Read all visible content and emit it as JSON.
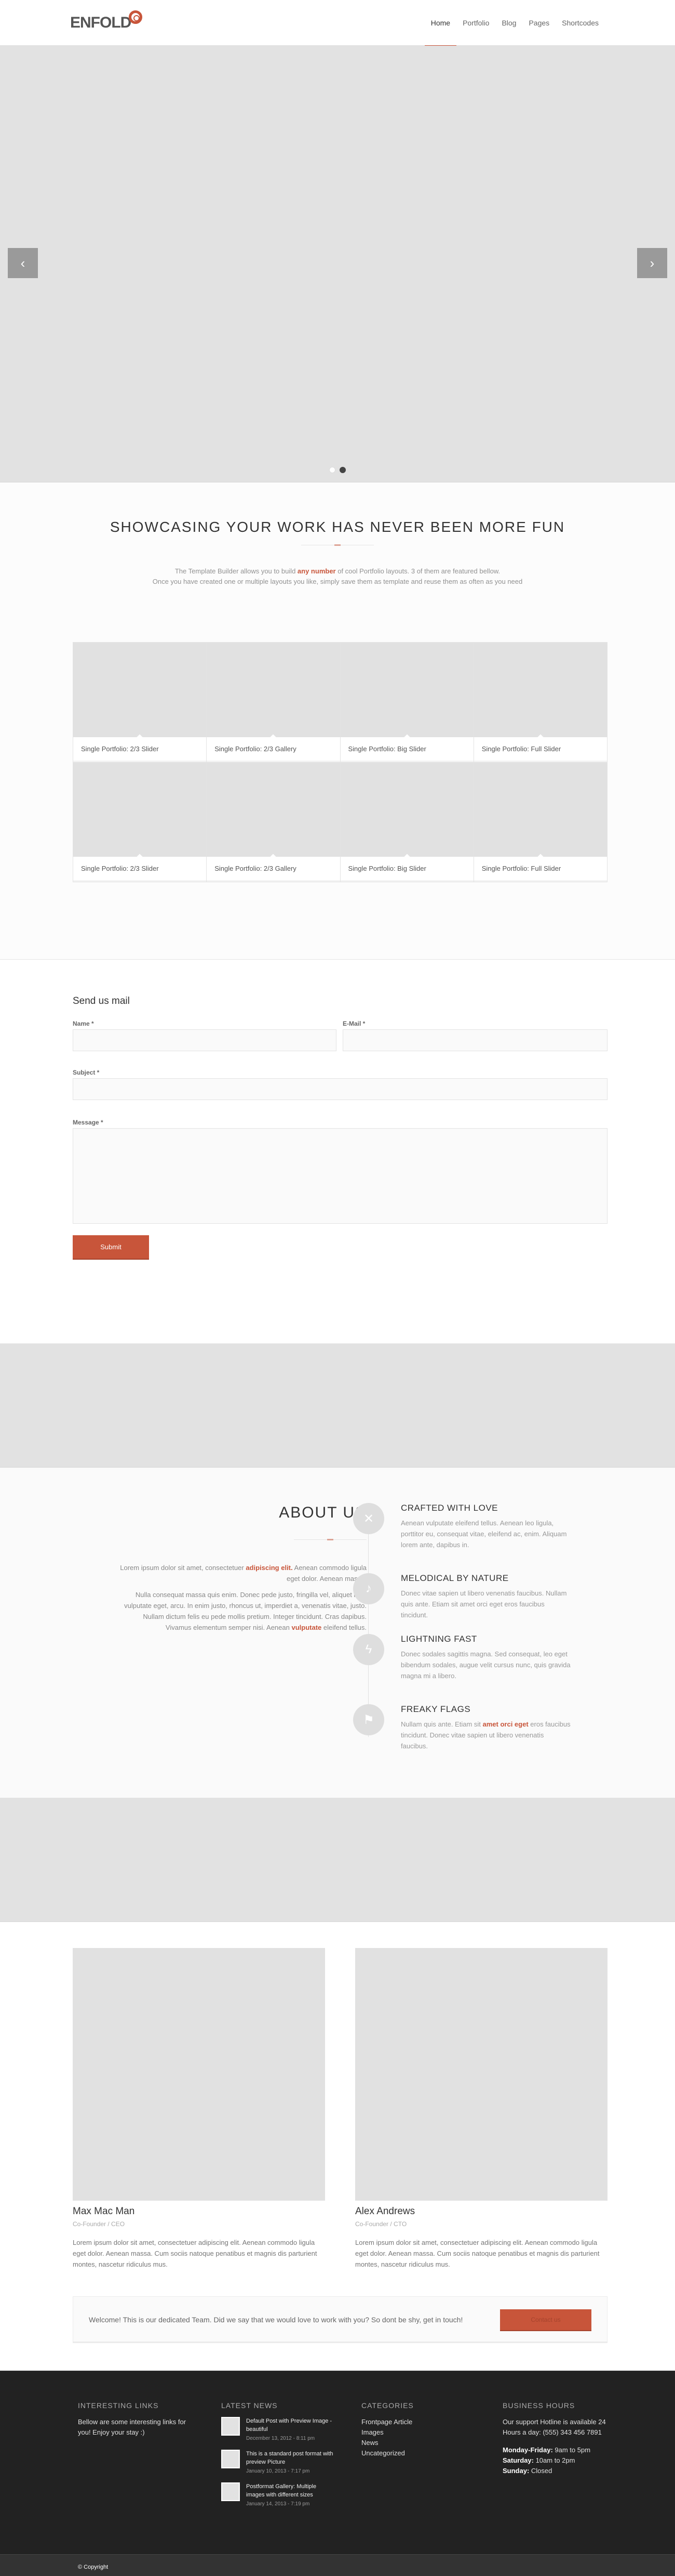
{
  "header": {
    "logo_text": "ENFOLD",
    "nav": [
      "Home",
      "Portfolio",
      "Blog",
      "Pages",
      "Shortcodes"
    ]
  },
  "slider": {
    "prev_icon": "chevron-left-icon",
    "next_icon": "chevron-right-icon",
    "prev_glyph": "‹",
    "next_glyph": "›",
    "dot_count": 2,
    "active_dot": 2
  },
  "showcase": {
    "title": "SHOWCASING YOUR WORK HAS NEVER BEEN MORE FUN",
    "intro_line1_a": "The Template Builder allows you to build ",
    "intro_line1_em": "any number",
    "intro_line1_b": " of cool Portfolio layouts. 3 of them are featured bellow.",
    "intro_line2": "Once you have created one or multiple layouts you like, simply save them as template and reuse them as often as you need",
    "portfolio_rows": [
      [
        "Single Portfolio: 2/3 Slider",
        "Single Portfolio: 2/3 Gallery",
        "Single Portfolio: Big Slider",
        "Single Portfolio: Full Slider"
      ],
      [
        "Single Portfolio: 2/3 Slider",
        "Single Portfolio: 2/3 Gallery",
        "Single Portfolio: Big Slider",
        "Single Portfolio: Full Slider"
      ]
    ]
  },
  "contact": {
    "title": "Send us mail",
    "name_label": "Name *",
    "email_label": "E-Mail *",
    "subject_label": "Subject *",
    "message_label": "Message *",
    "submit_label": "Submit"
  },
  "about": {
    "title": "ABOUT US",
    "p1_a": "Lorem ipsum dolor sit amet, consectetuer ",
    "p1_hl": "adipiscing elit.",
    "p1_b": " Aenean commodo ligula eget dolor. Aenean massa.",
    "p2": "Nulla consequat massa quis enim. Donec pede justo, fringilla vel, aliquet nec, vulputate eget, arcu. In enim justo, rhoncus ut, imperdiet a, venenatis vitae, justo. Nullam dictum felis eu pede mollis pretium. Integer tincidunt. Cras dapibus. Vivamus elementum semper nisi. Aenean ",
    "p2_hl": "vulputate",
    "p2_b": " eleifend tellus.",
    "features": [
      {
        "icon": "tools-icon",
        "glyph": "✕",
        "title": "CRAFTED WITH LOVE",
        "text": "Aenean vulputate eleifend tellus. Aenean leo ligula, porttitor eu, consequat vitae, eleifend ac, enim. Aliquam lorem ante, dapibus in."
      },
      {
        "icon": "music-note-icon",
        "glyph": "♪",
        "title": "MELODICAL BY NATURE",
        "text": "Donec vitae sapien ut libero venenatis faucibus. Nullam quis ante. Etiam sit amet orci eget eros faucibus tincidunt."
      },
      {
        "icon": "lightning-icon",
        "glyph": "ϟ",
        "title": "LIGHTNING FAST",
        "text": "Donec sodales sagittis magna. Sed consequat, leo eget bibendum sodales, augue velit cursus nunc, quis gravida magna mi a libero."
      },
      {
        "icon": "flag-icon",
        "glyph": "⚑",
        "title": "FREAKY FLAGS",
        "text_a": "Nullam quis ante. Etiam sit ",
        "text_hl": "amet orci eget",
        "text_b": " eros faucibus tincidunt. Donec vitae sapien ut libero venenatis faucibus."
      }
    ]
  },
  "team": {
    "members": [
      {
        "name": "Max Mac Man",
        "role": "Co-Founder / CEO",
        "text": "Lorem ipsum dolor sit amet, consectetuer adipiscing elit. Aenean commodo ligula eget dolor. Aenean massa. Cum sociis natoque penatibus et magnis dis parturient montes, nascetur ridiculus mus."
      },
      {
        "name": "Alex Andrews",
        "role": "Co-Founder / CTO",
        "text": "Lorem ipsum dolor sit amet, consectetuer adipiscing elit. Aenean commodo ligula eget dolor. Aenean massa. Cum sociis natoque penatibus et magnis dis parturient montes, nascetur ridiculus mus."
      }
    ],
    "callout_text": "Welcome! This is our dedicated Team. Did we say that we would love to work with you? So dont be shy, get in touch!",
    "callout_button": "Contact us"
  },
  "footer": {
    "links_title": "INTERESTING LINKS",
    "links_text": "Bellow are some interesting links for you! Enjoy your stay :)",
    "news_title": "LATEST NEWS",
    "news": [
      {
        "title": "Default Post with Preview Image - beautiful",
        "date": "December 13, 2012 - 8:11 pm"
      },
      {
        "title": "This is a standard post format with preview Picture",
        "date": "January 10, 2013 - 7:17 pm"
      },
      {
        "title": "Postformat Gallery: Multiple images with different sizes",
        "date": "January 14, 2013 - 7:19 pm"
      }
    ],
    "categories_title": "CATEGORIES",
    "categories": [
      "Frontpage Article",
      "Images",
      "News",
      "Uncategorized"
    ],
    "hours_title": "BUSINESS HOURS",
    "hours_intro": "Our support Hotline is available 24 Hours a day: (555) 343 456 7891",
    "hours": [
      {
        "day": "Monday-Friday:",
        "time": " 9am to 5pm"
      },
      {
        "day": "Saturday:",
        "time": " 10am to 2pm"
      },
      {
        "day": "Sunday:",
        "time": " Closed"
      }
    ],
    "copyright": "© Copyright"
  },
  "colors": {
    "accent": "#c8553a",
    "placeholder": "#e2e2e2",
    "footer_bg": "#222222",
    "socket_bg": "#333333"
  }
}
